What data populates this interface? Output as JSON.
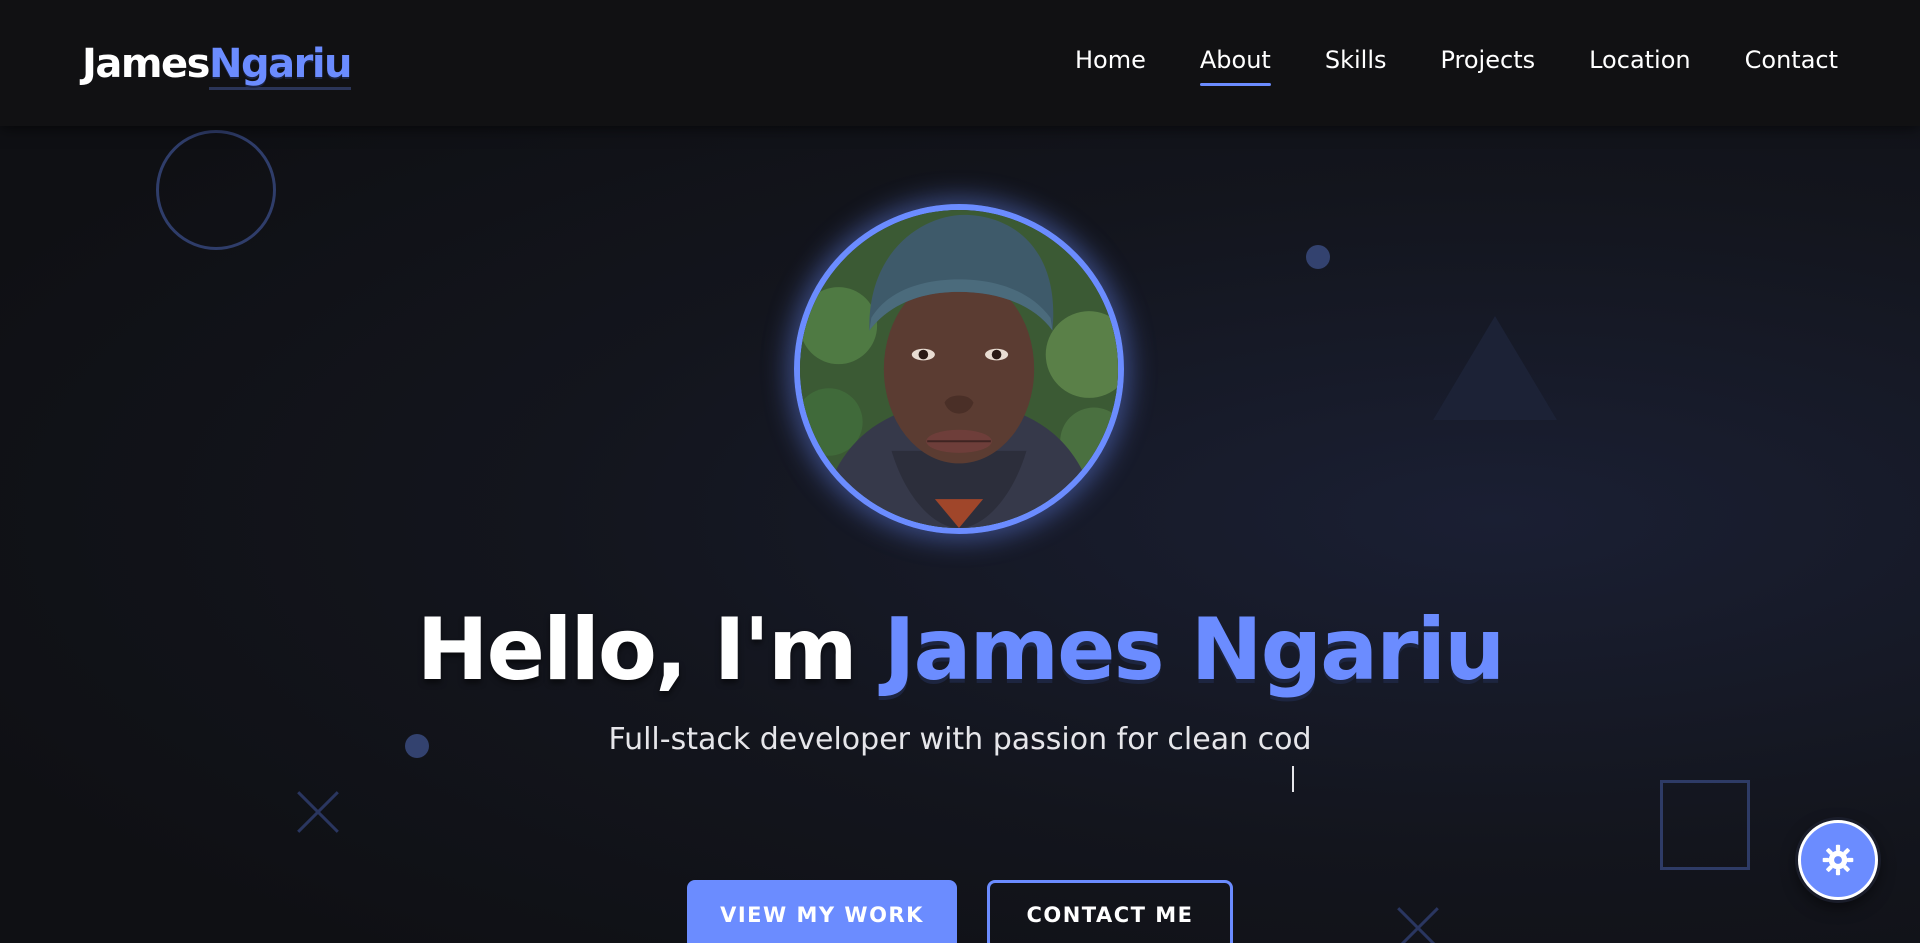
{
  "header": {
    "logo_first": "James",
    "logo_last": "Ngariu",
    "nav": [
      {
        "label": "Home",
        "active": false
      },
      {
        "label": "About",
        "active": true
      },
      {
        "label": "Skills",
        "active": false
      },
      {
        "label": "Projects",
        "active": false
      },
      {
        "label": "Location",
        "active": false
      },
      {
        "label": "Contact",
        "active": false
      }
    ]
  },
  "hero": {
    "greeting": "Hello, I'm ",
    "name": "James Ngariu",
    "subtitle": "Full-stack developer with passion for clean cod",
    "primary_button": "VIEW MY WORK",
    "secondary_button": "CONTACT ME"
  },
  "icons": {
    "settings": "gear-icon",
    "avatar": "profile-photo"
  },
  "colors": {
    "accent": "#6b8cff",
    "background": "#0f0f12",
    "header": "#111113"
  }
}
